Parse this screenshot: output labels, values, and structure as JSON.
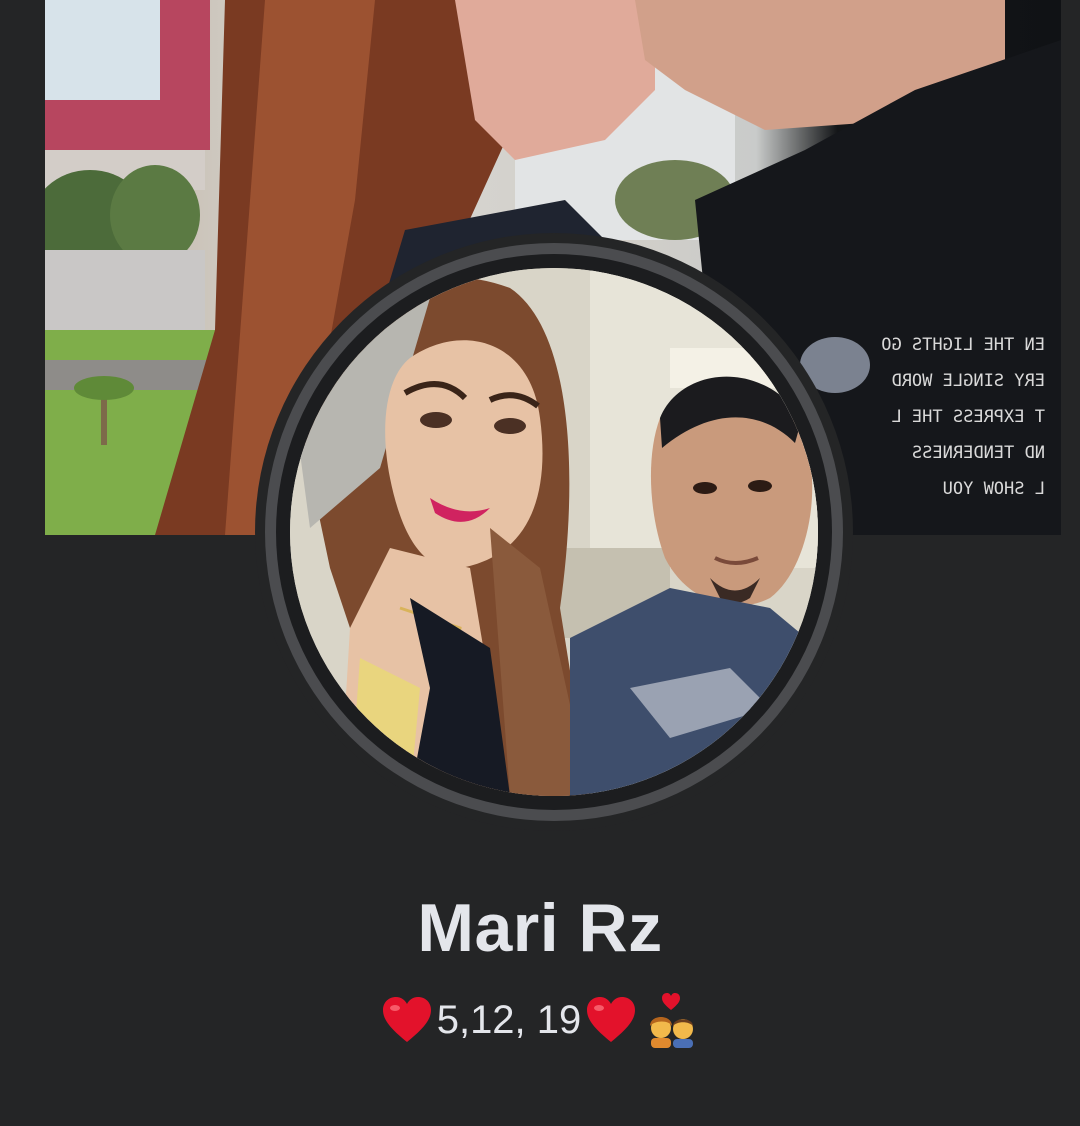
{
  "profile": {
    "name": "Mari Rz",
    "bio": {
      "text": "5,12, 19",
      "leading_emoji": "red-heart",
      "trailing_emoji": [
        "red-heart",
        "couple-with-heart"
      ]
    }
  },
  "colors": {
    "background": "#242526",
    "text": "#e4e6eb",
    "avatar_ring": "#4b4c4f",
    "heart": "#e3122b"
  },
  "cover_photo": {
    "shirt_text": [
      "EN THE LIGHTS GO",
      "ERY SINGLE WORD",
      "T EXPRESS THE L",
      "ND TENDERNESS",
      "L SHOW YOU"
    ]
  }
}
